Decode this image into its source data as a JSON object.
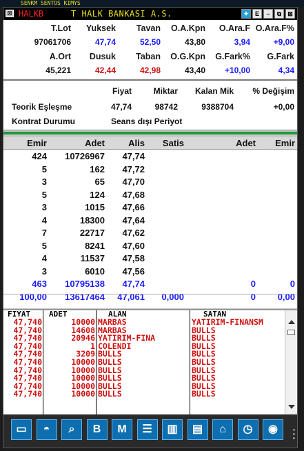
{
  "background": {
    "ticker_text": "SENKM    SENTOS KIMYS"
  },
  "window": {
    "symbol": "HALKB",
    "name": "T HALK BANKASI A.S.",
    "buttons": [
      "E",
      "–",
      "⧉",
      "⊠"
    ]
  },
  "quote": {
    "headers1": [
      "T.Lot",
      "Yuksek",
      "Tavan",
      "O.A.Kpn",
      "O.Ara.F",
      "O.Ara.F%"
    ],
    "values1": [
      "97061706",
      "47,74",
      "52,50",
      "43,80",
      "3,94",
      "+9,00"
    ],
    "headers2": [
      "A.Ort",
      "Dusuk",
      "Taban",
      "O.G.Kpn",
      "G.Fark%",
      "G.Fark"
    ],
    "values2": [
      "45,221",
      "42,44",
      "42,98",
      "43,40",
      "+10,00",
      "4,34"
    ]
  },
  "theoretical": {
    "headers": [
      "Fiyat",
      "Miktar",
      "Kalan Mik",
      "% Değişim"
    ],
    "row_label": "Teorik Eşleşme",
    "row_values": [
      "47,74",
      "98742",
      "9388704",
      "+0,00"
    ],
    "status_label": "Kontrat Durumu",
    "status_value": "Seans dışı Periyot"
  },
  "depth": {
    "headers": [
      "Emir",
      "Adet",
      "Alis",
      "Satis",
      "Adet",
      "Emir"
    ],
    "rows": [
      [
        "424",
        "10726967",
        "47,74"
      ],
      [
        "5",
        "162",
        "47,72"
      ],
      [
        "3",
        "65",
        "47,70"
      ],
      [
        "5",
        "124",
        "47,68"
      ],
      [
        "3",
        "1015",
        "47,66"
      ],
      [
        "4",
        "18300",
        "47,64"
      ],
      [
        "7",
        "22717",
        "47,62"
      ],
      [
        "5",
        "8241",
        "47,60"
      ],
      [
        "4",
        "11537",
        "47,58"
      ],
      [
        "3",
        "6010",
        "47,56"
      ]
    ],
    "total": [
      "463",
      "10795138",
      "47,74",
      "0",
      "0"
    ],
    "summary": [
      "100,00",
      "13617464",
      "47,061",
      "0,000",
      "0",
      "0,00"
    ]
  },
  "trades": {
    "headers": [
      "FIYAT",
      "ADET",
      "ALAN",
      "SATAN"
    ],
    "rows": [
      [
        "47,740",
        "10000",
        "MARBAS",
        "YATIRIM-FINANSM"
      ],
      [
        "47,740",
        "14608",
        "MARBAS",
        "BULLS"
      ],
      [
        "47,740",
        "20946",
        "YATIRIM-FINA",
        "BULLS"
      ],
      [
        "47,740",
        "1",
        "COLENDI",
        "BULLS"
      ],
      [
        "47,740",
        "3209",
        "BULLS",
        "BULLS"
      ],
      [
        "47,740",
        "10000",
        "BULLS",
        "BULLS"
      ],
      [
        "47,740",
        "10000",
        "BULLS",
        "BULLS"
      ],
      [
        "47,740",
        "10000",
        "BULLS",
        "BULLS"
      ],
      [
        "47,740",
        "10000",
        "BULLS",
        "BULLS"
      ],
      [
        "47,740",
        "10000",
        "BULLS",
        "BULLS"
      ]
    ]
  },
  "toolbar": {
    "icons": [
      "monitor-icon",
      "globe-icon",
      "chart-search-icon",
      "b-icon",
      "m-icon",
      "list-icon",
      "bar-chart-icon",
      "document-icon",
      "home-money-icon",
      "clock-icon",
      "browser-icon"
    ],
    "glyphs": [
      "▭",
      "◓",
      "⌕",
      "B",
      "M",
      "☰",
      "▥",
      "▤",
      "⌂",
      "◷",
      "◉"
    ]
  }
}
